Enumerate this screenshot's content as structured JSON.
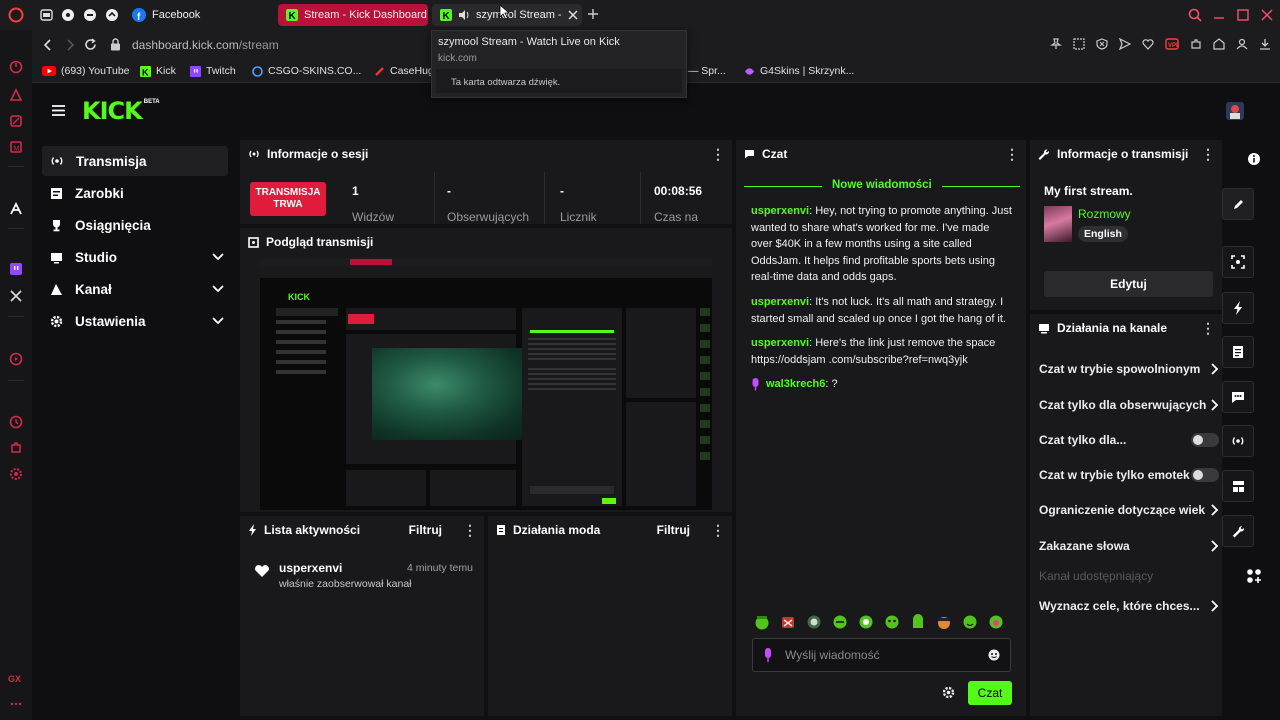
{
  "browser": {
    "tabs": [
      {
        "label": "Facebook"
      },
      {
        "label": "Stream - Kick Dashboard"
      },
      {
        "label": "szymool Stream -"
      }
    ],
    "tooltip": {
      "title": "szymool Stream - Watch Live on Kick",
      "domain": "kick.com",
      "note": "Ta karta odtwarza dźwięk."
    },
    "url_host": "dashboard.kick.com",
    "url_path": "/stream",
    "bookmarks": [
      {
        "label": "(693) YouTube"
      },
      {
        "label": "Kick"
      },
      {
        "label": "Twitch"
      },
      {
        "label": "CSGO-SKINS.CO..."
      },
      {
        "label": "CaseHug"
      },
      {
        "label": "/ — Spr..."
      },
      {
        "label": "G4Skins | Skrzynk..."
      }
    ]
  },
  "brand": {
    "logo": "KICK",
    "badge": "BETA",
    "accent": "#53fc18"
  },
  "sidebar": {
    "items": [
      {
        "label": "Transmisja"
      },
      {
        "label": "Zarobki"
      },
      {
        "label": "Osiągnięcia"
      },
      {
        "label": "Studio"
      },
      {
        "label": "Kanał"
      },
      {
        "label": "Ustawienia"
      }
    ]
  },
  "session": {
    "title": "Informacje o sesji",
    "live_badge_line1": "TRANSMISJA",
    "live_badge_line2": "TRWA",
    "stats": [
      {
        "value": "1",
        "label": "Widzów"
      },
      {
        "value": "-",
        "label": "Obserwujących"
      },
      {
        "value": "-",
        "label": "Licznik"
      },
      {
        "value": "00:08:56",
        "label": "Czas na"
      }
    ]
  },
  "preview": {
    "title": "Podgląd transmisji"
  },
  "activity": {
    "title": "Lista aktywności",
    "filter": "Filtruj",
    "items": [
      {
        "user": "usperxenvi",
        "time": "4 minuty temu",
        "text": "właśnie zaobserwował kanał"
      }
    ]
  },
  "mod": {
    "title": "Działania moda",
    "filter": "Filtruj"
  },
  "chat": {
    "title": "Czat",
    "new_messages": "Nowe wiadomości",
    "messages": [
      {
        "user": "usperxenvi",
        "text": ": Hey, not trying to promote anything. Just wanted to share what's worked for me. I've made over $40K in a few months using a site called OddsJam. It helps find profitable sports bets using real-time data and odds gaps."
      },
      {
        "user": "usperxenvi",
        "text": ": It's not luck. It's all math and strategy. I started small and scaled up once I got the hang of it."
      },
      {
        "user": "usperxenvi",
        "text": ": Here's the link just remove the space https://oddsjam .com/subscribe?ref=nwq3yjk"
      },
      {
        "user": "wal3krech6",
        "text": ": ?"
      }
    ],
    "input_placeholder": "Wyślij wiadomość",
    "send_label": "Czat"
  },
  "stream_info": {
    "title": "Informacje o transmisji",
    "stream_title": "My first stream.",
    "category": "Rozmowy",
    "language": "English",
    "edit_label": "Edytuj"
  },
  "channel_actions": {
    "title": "Działania na kanale",
    "items": [
      {
        "label": "Czat w trybie spowolnionym",
        "kind": "arrow"
      },
      {
        "label": "Czat tylko dla obserwujących",
        "kind": "arrow"
      },
      {
        "label": "Czat tylko dla...",
        "kind": "toggle"
      },
      {
        "label": "Czat w trybie tylko emotek",
        "kind": "toggle"
      },
      {
        "label": "Ograniczenie dotyczące wiek",
        "kind": "arrow"
      },
      {
        "label": "Zakazane słowa",
        "kind": "arrow"
      },
      {
        "label": "Kanał udostępniający",
        "kind": "disabled"
      },
      {
        "label": "Wyznacz cele, które chces...",
        "kind": "arrow"
      }
    ]
  }
}
